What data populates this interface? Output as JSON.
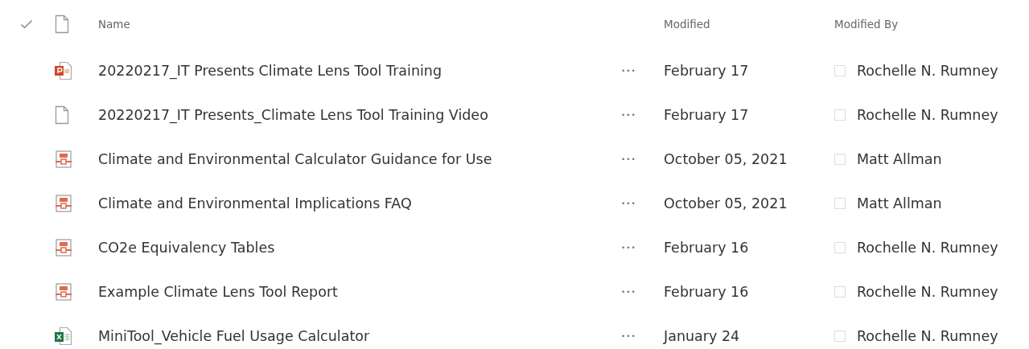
{
  "table": {
    "columns": [
      {
        "label": "Name"
      },
      {
        "label": "Modified"
      },
      {
        "label": "Modified By"
      }
    ],
    "rows": [
      {
        "kind": "pptx",
        "name": "20220217_IT Presents Climate Lens Tool Training",
        "more": "•••",
        "modified": "February 17",
        "modified_by": "Rochelle N. Rumney"
      },
      {
        "kind": "file",
        "name": "20220217_IT Presents_Climate Lens Tool Training Video",
        "more": "•••",
        "modified": "February 17",
        "modified_by": "Rochelle N. Rumney"
      },
      {
        "kind": "pdf",
        "name": "Climate and Environmental Calculator Guidance for Use",
        "more": "•••",
        "modified": "October 05, 2021",
        "modified_by": "Matt Allman"
      },
      {
        "kind": "pdf",
        "name": "Climate and Environmental Implications FAQ",
        "more": "•••",
        "modified": "October 05, 2021",
        "modified_by": "Matt Allman"
      },
      {
        "kind": "pdf",
        "name": "CO2e Equivalency Tables",
        "more": "•••",
        "modified": "February 16",
        "modified_by": "Rochelle N. Rumney"
      },
      {
        "kind": "pdf",
        "name": "Example Climate Lens Tool Report",
        "more": "•••",
        "modified": "February 16",
        "modified_by": "Rochelle N. Rumney"
      },
      {
        "kind": "xlsx",
        "name": "MiniTool_Vehicle Fuel Usage Calculator",
        "more": "•••",
        "modified": "January 24",
        "modified_by": "Rochelle N. Rumney"
      }
    ]
  }
}
